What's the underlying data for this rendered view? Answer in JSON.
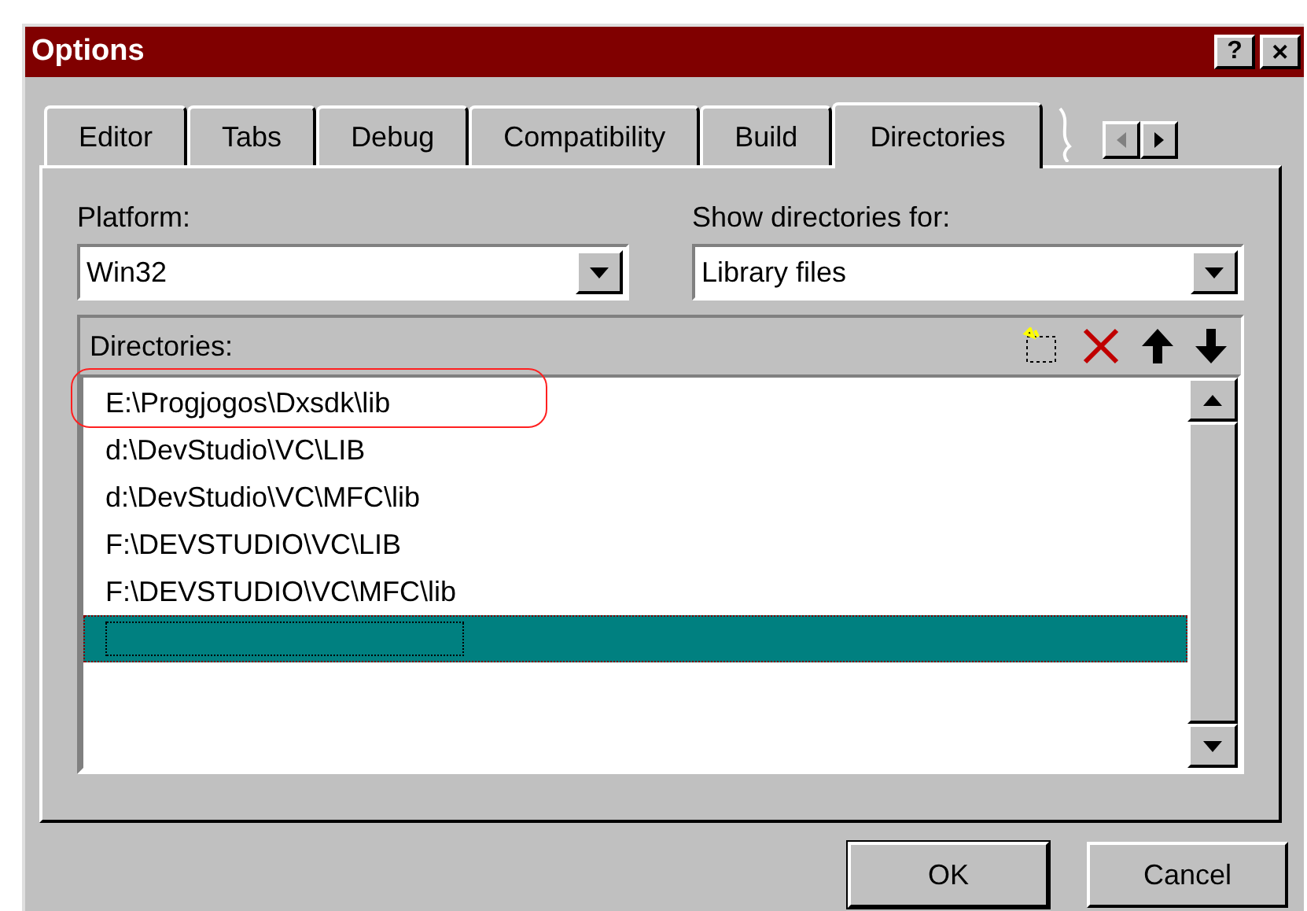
{
  "window": {
    "title": "Options",
    "help_button": "?",
    "close_button": "✕"
  },
  "tabs": [
    {
      "label": "Editor",
      "selected": false
    },
    {
      "label": "Tabs",
      "selected": false
    },
    {
      "label": "Debug",
      "selected": false
    },
    {
      "label": "Compatibility",
      "selected": false
    },
    {
      "label": "Build",
      "selected": false
    },
    {
      "label": "Directories",
      "selected": true
    }
  ],
  "tab_scroll": {
    "left_disabled": true,
    "right_disabled": false
  },
  "platform": {
    "label": "Platform:",
    "value": "Win32"
  },
  "show_for": {
    "label": "Show directories for:",
    "value": "Library files"
  },
  "directories": {
    "label": "Directories:",
    "rows": [
      {
        "text": "E:\\Progjogos\\Dxsdk\\lib",
        "selected": false,
        "circled": true
      },
      {
        "text": "d:\\DevStudio\\VC\\LIB",
        "selected": false,
        "circled": false
      },
      {
        "text": "d:\\DevStudio\\VC\\MFC\\lib",
        "selected": false,
        "circled": false
      },
      {
        "text": "F:\\DEVSTUDIO\\VC\\LIB",
        "selected": false,
        "circled": false
      },
      {
        "text": "F:\\DEVSTUDIO\\VC\\MFC\\lib",
        "selected": false,
        "circled": false
      },
      {
        "text": "",
        "selected": true,
        "circled": false,
        "kind": "new"
      }
    ]
  },
  "buttons": [
    {
      "label": "OK",
      "default": true
    },
    {
      "label": "Cancel",
      "default": false
    }
  ]
}
